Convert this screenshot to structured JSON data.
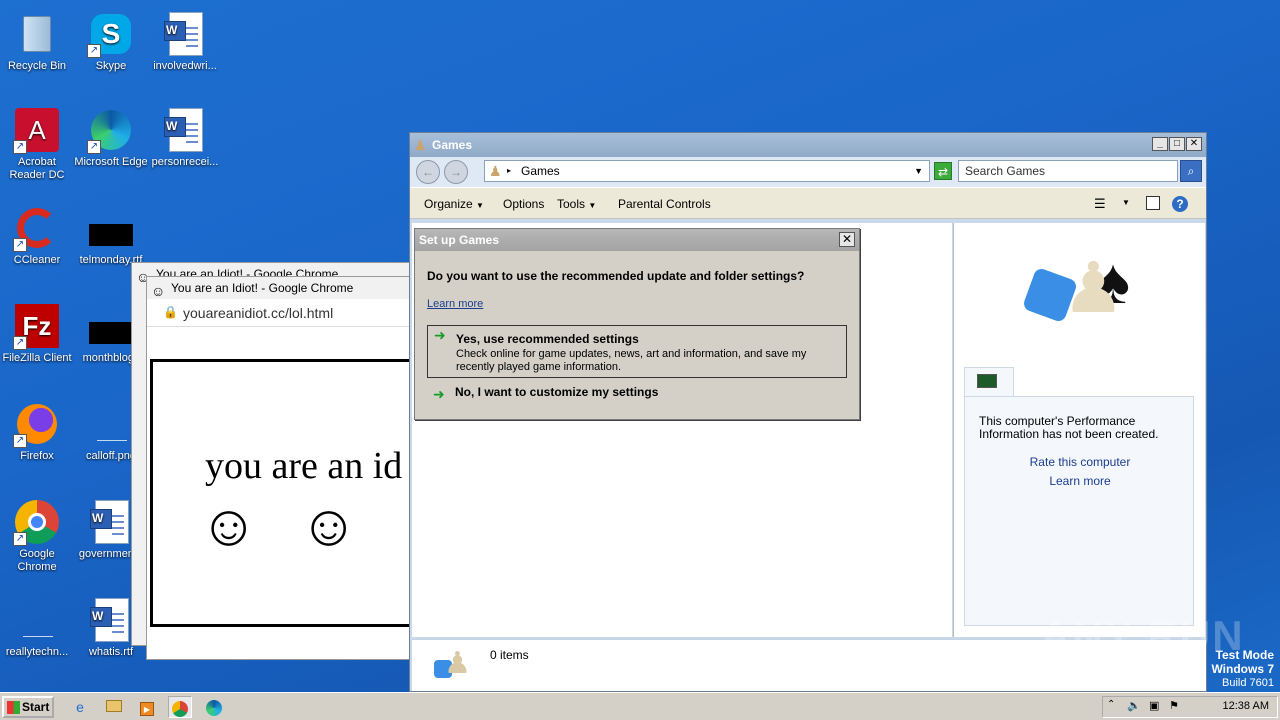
{
  "desktop": {
    "icons": [
      {
        "label": "Recycle Bin"
      },
      {
        "label": "Skype"
      },
      {
        "label": "involvedwri..."
      },
      {
        "label": "Acrobat Reader DC"
      },
      {
        "label": "Microsoft Edge"
      },
      {
        "label": "personrecei..."
      },
      {
        "label": "CCleaner"
      },
      {
        "label": "telmonday.rtf"
      },
      {
        "label": "FileZilla Client"
      },
      {
        "label": "monthblogs"
      },
      {
        "label": "Firefox"
      },
      {
        "label": "calloff.png"
      },
      {
        "label": "Google Chrome"
      },
      {
        "label": "governmen..."
      },
      {
        "label": "reallytechn..."
      },
      {
        "label": "whatis.rtf"
      }
    ]
  },
  "games_window": {
    "title": "Games",
    "address": "Games",
    "search_placeholder": "Search Games",
    "menus": [
      "Organize",
      "Options",
      "Tools",
      "Parental Controls"
    ],
    "status_items": "0 items",
    "perf_text": "This computer's Performance Information has not been created.",
    "rate_link": "Rate this computer",
    "learn_more": "Learn more",
    "buttons": {
      "min": "_",
      "max": "□",
      "close": "✕"
    }
  },
  "dialog": {
    "title": "Set up Games",
    "question": "Do you want to use the recommended update and folder settings?",
    "learn_more": "Learn more",
    "option1_title": "Yes, use recommended settings",
    "option1_desc": "Check online for game updates, news, art and information, and save my recently played game information.",
    "option2_title": "No, I want to customize my settings"
  },
  "chrome": {
    "back_title": "You are an Idiot! - Google Chrome",
    "title": "You are an Idiot! - Google Chrome",
    "url": "youareanidiot.cc/lol.html",
    "page_text": "you are an id",
    "smileys": [
      "☺",
      "☺"
    ]
  },
  "taskbar": {
    "start": "Start",
    "time": "12:38 AM"
  },
  "watermark": {
    "line1": "Test Mode",
    "line2": "Windows 7",
    "line3": "Build 7601",
    "brand": "ANY RUN"
  }
}
